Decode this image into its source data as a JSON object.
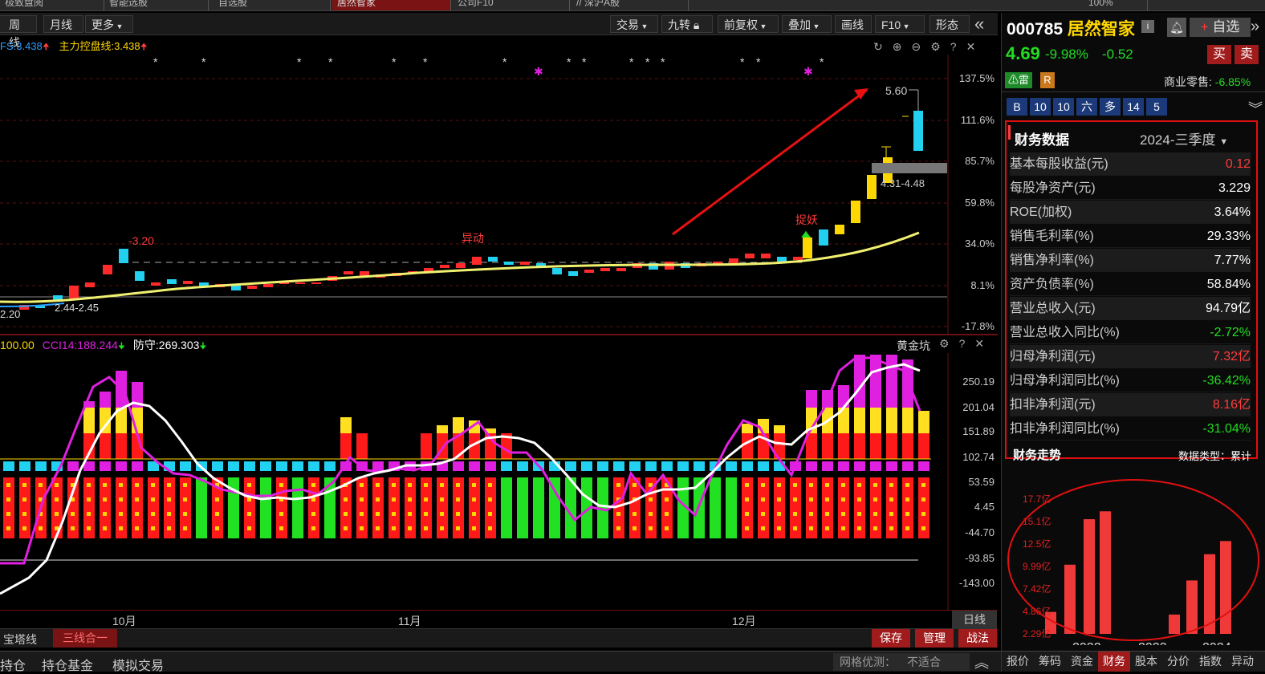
{
  "top_tabs": [
    "极致盘阅",
    "智能选股",
    "自选股",
    "居然智家",
    "公司F10",
    "// 深沪A股",
    "100%"
  ],
  "toolbar": {
    "week": "周线",
    "month": "月线",
    "more": "更多",
    "trade": "交易",
    "nine": "九转",
    "adjust": "前复权",
    "overlay": "叠加",
    "draw": "画线",
    "f10": "F10",
    "shape": "形态"
  },
  "main_legend": {
    "fs": "FS:3.438",
    "main_line": "主力控盘线:3.438"
  },
  "main_yaxis": [
    "137.5%",
    "111.6%",
    "85.7%",
    "59.8%",
    "34.0%",
    "8.1%",
    "-17.8%"
  ],
  "annotations": {
    "high": "5.60",
    "low_left": "-3.20",
    "range_low": "2.44-2.45",
    "left_val": "2.20",
    "unusual": "异动",
    "demon": "捉妖",
    "gap": "4.31-4.48"
  },
  "sub_legend": {
    "v100": "100.00",
    "cci": "CCI14:188.244",
    "defend": "防守:269.303",
    "indicator_name": "黄金坑"
  },
  "sub_yaxis": [
    "250.19",
    "201.04",
    "151.89",
    "102.74",
    "53.59",
    "4.45",
    "-44.70",
    "-93.85",
    "-143.00"
  ],
  "xaxis": {
    "oct": "10月",
    "nov": "11月",
    "dec": "12月",
    "period": "日线"
  },
  "bottom": {
    "tab1": "宝塔线",
    "tab2": "三线合一",
    "save": "保存",
    "manage": "管理",
    "tactic": "战法"
  },
  "status": {
    "hold": "持仓",
    "fund": "持仓基金",
    "sim": "模拟交易",
    "grid": "网格优测：",
    "notfit": "不适合"
  },
  "stock": {
    "code": "000785",
    "name": "居然智家",
    "price": "4.69",
    "pct": "-9.98%",
    "chg": "-0.52",
    "fav": "自选",
    "buy": "买",
    "sell": "卖",
    "thunder": "雷",
    "r": "R",
    "industry": "商业零售:",
    "ind_pct": "-6.85%"
  },
  "tags": [
    "B",
    "10",
    "10",
    "六",
    "多",
    "14",
    "5"
  ],
  "fin": {
    "title": "财务数据",
    "period": "2024-三季度",
    "rows": [
      {
        "label": "基本每股收益(元)",
        "value": "0.12",
        "color": "#ff3b3b"
      },
      {
        "label": "每股净资产(元)",
        "value": "3.229",
        "color": "#ffffff"
      },
      {
        "label": "ROE(加权)",
        "value": "3.64%",
        "color": "#ffffff"
      },
      {
        "label": "销售毛利率(%)",
        "value": "29.33%",
        "color": "#ffffff"
      },
      {
        "label": "销售净利率(%)",
        "value": "7.77%",
        "color": "#ffffff"
      },
      {
        "label": "资产负债率(%)",
        "value": "58.84%",
        "color": "#ffffff"
      },
      {
        "label": "营业总收入(元)",
        "value": "94.79亿",
        "color": "#ffffff"
      },
      {
        "label": "营业总收入同比(%)",
        "value": "-2.72%",
        "color": "#22dd22"
      },
      {
        "label": "归母净利润(元)",
        "value": "7.32亿",
        "color": "#ff3b3b"
      },
      {
        "label": "归母净利润同比(%)",
        "value": "-36.42%",
        "color": "#22dd22"
      },
      {
        "label": "扣非净利润(元)",
        "value": "8.16亿",
        "color": "#ff3b3b"
      },
      {
        "label": "扣非净利润同比(%)",
        "value": "-31.04%",
        "color": "#22dd22"
      }
    ],
    "trend_title": "财务走势",
    "data_type": "数据类型：累计"
  },
  "chart_data": {
    "type": "bar",
    "ylabels": [
      "17.7亿",
      "15.1亿",
      "12.5亿",
      "9.99亿",
      "7.42亿",
      "4.86亿",
      "2.29亿"
    ],
    "xlabels": [
      "2022",
      "2023",
      "2024"
    ],
    "values": [
      4.8,
      10.2,
      15.4,
      16.3,
      4.5,
      8.4,
      11.4,
      12.9,
      3.6,
      6.1,
      7.3
    ],
    "ylim": [
      2.29,
      17.7
    ]
  },
  "side_tabs": [
    "报价",
    "筹码",
    "资金",
    "财务",
    "股本",
    "分价",
    "指数",
    "异动"
  ]
}
